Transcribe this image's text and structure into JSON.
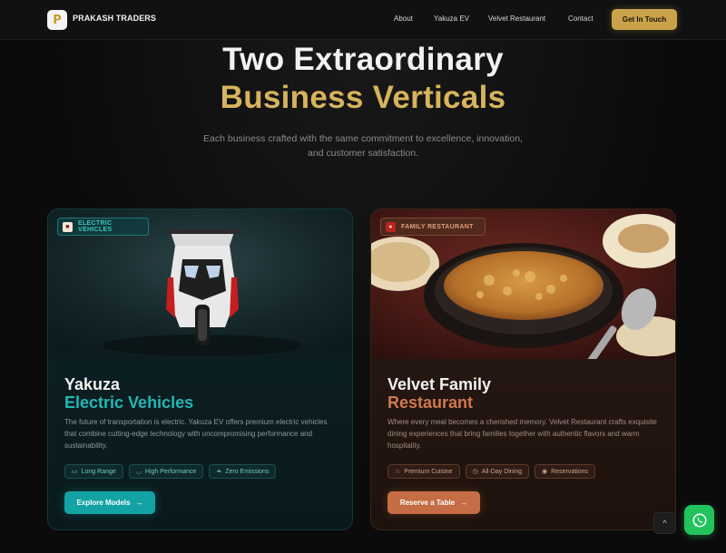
{
  "brand": {
    "name": "PRAKASH TRADERS",
    "logo_glyph": "P"
  },
  "nav": {
    "links": [
      "About",
      "Yakuza EV",
      "Velvet Restaurant",
      "Contact"
    ],
    "cta_label": "Get In Touch"
  },
  "hero": {
    "line1": "Two Extraordinary",
    "line2": "Business Verticals",
    "subtitle_line1": "Each business crafted with the same commitment to excellence, innovation,",
    "subtitle_line2": "and customer satisfaction."
  },
  "cards": [
    {
      "badge": "ELECTRIC VEHICLES",
      "title1": "Yakuza",
      "title2": "Electric Vehicles",
      "accent": "#22b8b5",
      "desc": "The future of transportation is electric. Yakuza EV offers premium electric vehicles that combine cutting-edge technology with uncompromising performance and sustainability.",
      "chips": [
        "Long Range",
        "High Performance",
        "Zero Emissions"
      ],
      "chip_icons": [
        "battery-icon",
        "gauge-icon",
        "leaf-icon"
      ],
      "button": "Explore Models"
    },
    {
      "badge": "FAMILY RESTAURANT",
      "title1": "Velvet Family",
      "title2": "Restaurant",
      "accent": "#d07a4c",
      "desc": "Where every meal becomes a cherished memory. Velvet Restaurant crafts exquisite dining experiences that bring families together with authentic flavors and warm hospitality.",
      "chips": [
        "Premium Cuisine",
        "All-Day Dining",
        "Reservations"
      ],
      "chip_icons": [
        "star-icon",
        "clock-icon",
        "location-pin-icon"
      ],
      "button": "Reserve a Table"
    }
  ],
  "floating": {
    "scroll_top": "^",
    "whatsapp": "whatsapp-icon"
  }
}
